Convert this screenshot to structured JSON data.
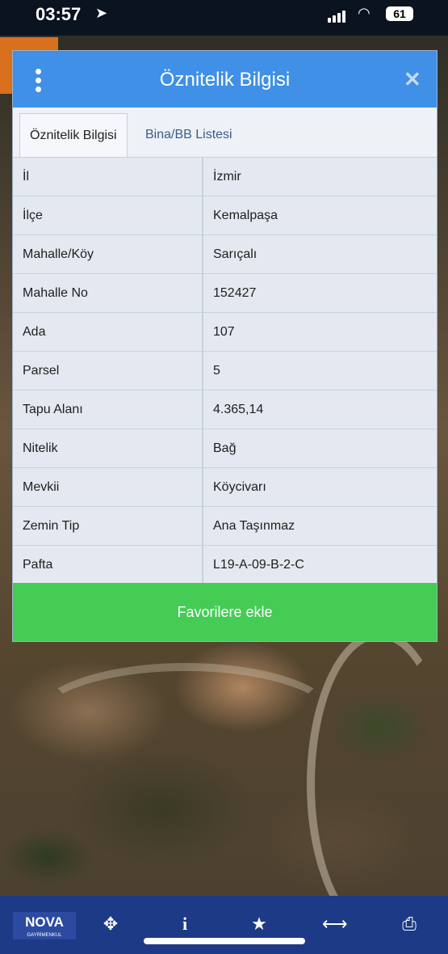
{
  "status_bar": {
    "time": "03:57",
    "battery": "61"
  },
  "dialog": {
    "title": "Öznitelik Bilgisi",
    "tabs": [
      {
        "label": "Öznitelik Bilgisi",
        "active": true
      },
      {
        "label": "Bina/BB Listesi",
        "active": false
      }
    ],
    "rows": [
      {
        "key": "İl",
        "value": "İzmir"
      },
      {
        "key": "İlçe",
        "value": "Kemalpaşa"
      },
      {
        "key": "Mahalle/Köy",
        "value": "Sarıçalı"
      },
      {
        "key": "Mahalle No",
        "value": "152427"
      },
      {
        "key": "Ada",
        "value": "107"
      },
      {
        "key": "Parsel",
        "value": "5"
      },
      {
        "key": "Tapu Alanı",
        "value": "4.365,14"
      },
      {
        "key": "Nitelik",
        "value": "Bağ"
      },
      {
        "key": "Mevkii",
        "value": "Köyciva­rı"
      },
      {
        "key": "Zemin Tip",
        "value": "Ana Taşınmaz"
      },
      {
        "key": "Pafta",
        "value": "L19-A-09-B-2-C"
      }
    ],
    "favorite_button": "Favorilere ekle"
  },
  "bottom_bar": {
    "logo_text": "NOVA",
    "logo_sub": "GAYRİMENKUL",
    "icons": [
      "crosshair-icon",
      "info-icon",
      "star-icon",
      "resize-arrows-icon",
      "printer-icon"
    ]
  },
  "colors": {
    "header": "#3f90e6",
    "favorite": "#44cc55",
    "bottom_bar": "#1d3a86"
  }
}
